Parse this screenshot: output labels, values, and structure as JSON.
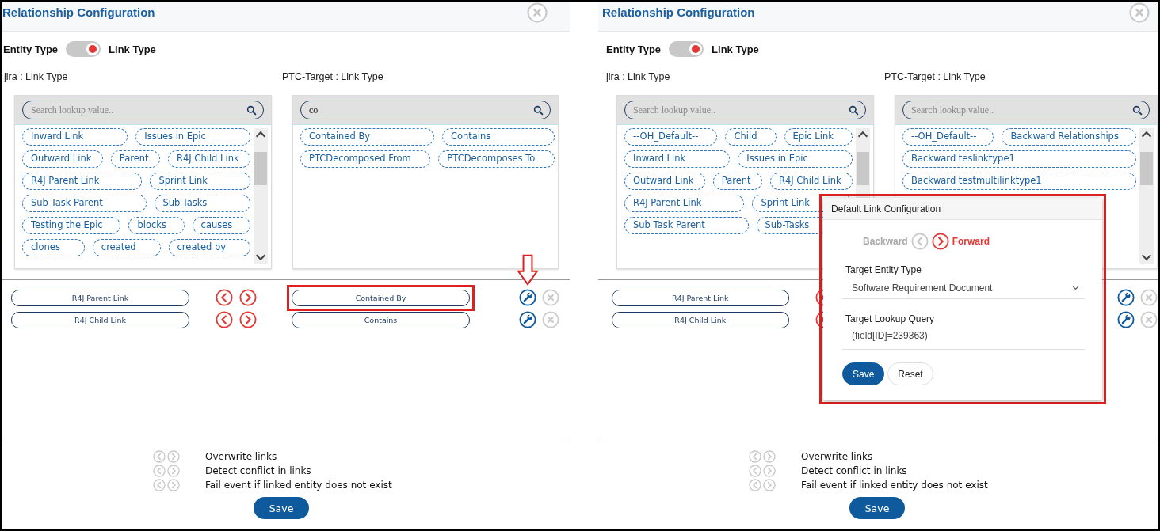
{
  "panels": [
    {
      "title": "Relationship Configuration",
      "toggle": {
        "left_label": "Entity Type",
        "right_label": "Link Type",
        "on": true
      },
      "source": {
        "label": "jira : Link Type",
        "scrollable": true,
        "search": {
          "placeholder": "Search lookup value.."
        },
        "chips": [
          "Inward Link",
          "Issues in Epic",
          "Outward Link",
          "Parent",
          "R4J Child Link",
          "R4J Parent Link",
          "Sprint Link",
          "Sub Task Parent",
          "Sub-Tasks",
          "Testing the Epic",
          "blocks",
          "causes",
          "clones",
          "created",
          "created by"
        ]
      },
      "target": {
        "label": "PTC-Target : Link Type",
        "scrollable": false,
        "search": {
          "value": "co"
        },
        "chips": [
          "Contained By",
          "Contains",
          "PTCDecomposed From",
          "PTCDecomposes To"
        ]
      },
      "mappings": [
        {
          "source": "R4J Parent Link",
          "target": "Contained By",
          "highlighted": true,
          "pointer": true
        },
        {
          "source": "R4J Child Link",
          "target": "Contains",
          "highlighted": false,
          "pointer": false
        }
      ],
      "options": [
        "Overwrite links",
        "Detect conflict in links",
        "Fail event if linked entity does not exist"
      ],
      "save": "Save"
    },
    {
      "title": "Relationship Configuration",
      "toggle": {
        "left_label": "Entity Type",
        "right_label": "Link Type",
        "on": true
      },
      "source": {
        "label": "jira : Link Type",
        "scrollable": true,
        "search": {
          "placeholder": "Search lookup value.."
        },
        "chips": [
          "--OH_Default--",
          "Child",
          "Epic Link",
          "Inward Link",
          "Issues in Epic",
          "Outward Link",
          "Parent",
          "R4J Child Link",
          "R4J Parent Link",
          "Sprint Link",
          "Sub Task Parent",
          "Sub-Tasks"
        ]
      },
      "target": {
        "label": "PTC-Target : Link Type",
        "scrollable": true,
        "search": {
          "placeholder": "Search lookup value.."
        },
        "chips": [
          "--OH_Default--",
          "Backward Relationships",
          "Backward teslinktype1",
          "Backward testmultilinktype1"
        ]
      },
      "mappings": [
        {
          "source": "R4J Parent Link"
        },
        {
          "source": "R4J Child Link"
        }
      ],
      "options": [
        "Overwrite links",
        "Detect conflict in links",
        "Fail event if linked entity does not exist"
      ],
      "save": "Save",
      "popup": {
        "title": "Default Link Configuration",
        "highlighted": true,
        "directions": [
          {
            "label": "Backward",
            "selected": false
          },
          {
            "label": "Forward",
            "selected": true
          }
        ],
        "fields": [
          {
            "kind": "select",
            "label": "Target Entity Type",
            "value": "Software Requirement Document"
          },
          {
            "kind": "text",
            "label": "Target Lookup Query",
            "value": "(field[ID]=239363)"
          }
        ],
        "buttons": [
          {
            "label": "Save",
            "kind": "primary"
          },
          {
            "label": "Reset",
            "kind": "secondary"
          }
        ]
      }
    }
  ]
}
